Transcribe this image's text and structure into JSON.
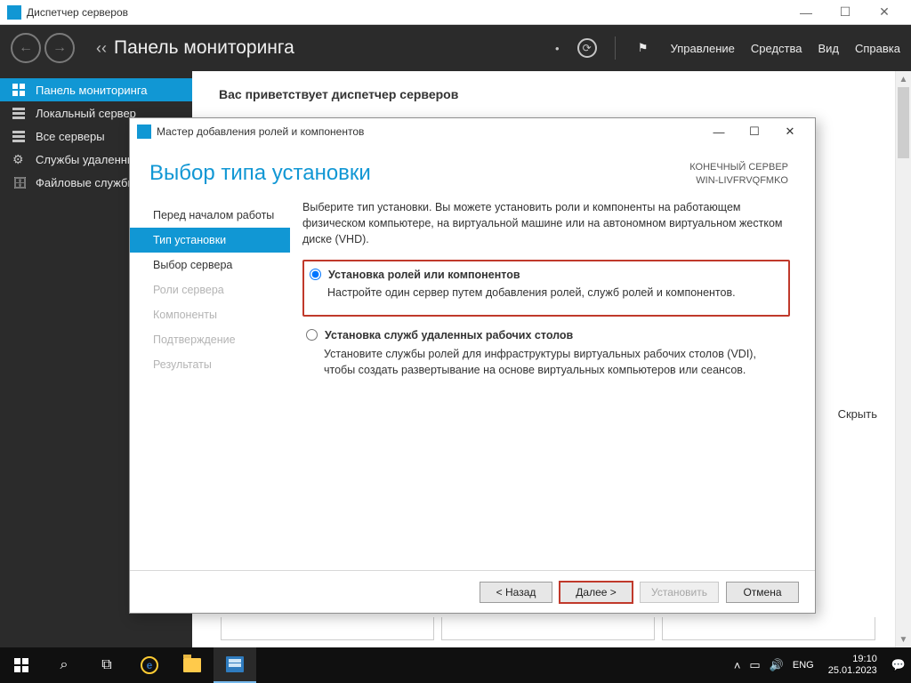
{
  "mainwin": {
    "title": "Диспетчер серверов"
  },
  "toolbar": {
    "title": "Панель мониторинга",
    "menu": {
      "manage": "Управление",
      "tools": "Средства",
      "view": "Вид",
      "help": "Справка"
    }
  },
  "sidebar": {
    "items": [
      {
        "label": "Панель мониторинга"
      },
      {
        "label": "Локальный сервер"
      },
      {
        "label": "Все серверы"
      },
      {
        "label": "Службы удаленных рабочих столов"
      },
      {
        "label": "Файловые службы и службы хранилища"
      }
    ]
  },
  "content": {
    "welcome": "Вас приветствует диспетчер серверов",
    "hide": "Скрыть"
  },
  "dialog": {
    "title": "Мастер добавления ролей и компонентов",
    "heading": "Выбор типа установки",
    "dest_label": "КОНЕЧНЫЙ СЕРВЕР",
    "dest_server": "WIN-LIVFRVQFMKO",
    "steps": [
      "Перед началом работы",
      "Тип установки",
      "Выбор сервера",
      "Роли сервера",
      "Компоненты",
      "Подтверждение",
      "Результаты"
    ],
    "intro": "Выберите тип установки. Вы можете установить роли и компоненты на работающем физическом компьютере, на виртуальной машине или на автономном виртуальном жестком диске (VHD).",
    "opt1_title": "Установка ролей или компонентов",
    "opt1_desc": "Настройте один сервер путем добавления ролей, служб ролей и компонентов.",
    "opt2_title": "Установка служб удаленных рабочих столов",
    "opt2_desc": "Установите службы ролей для инфраструктуры виртуальных рабочих столов (VDI), чтобы создать развертывание на основе виртуальных компьютеров или сеансов.",
    "buttons": {
      "back": "< Назад",
      "next": "Далее >",
      "install": "Установить",
      "cancel": "Отмена"
    }
  },
  "taskbar": {
    "lang": "ENG",
    "time": "19:10",
    "date": "25.01.2023"
  }
}
